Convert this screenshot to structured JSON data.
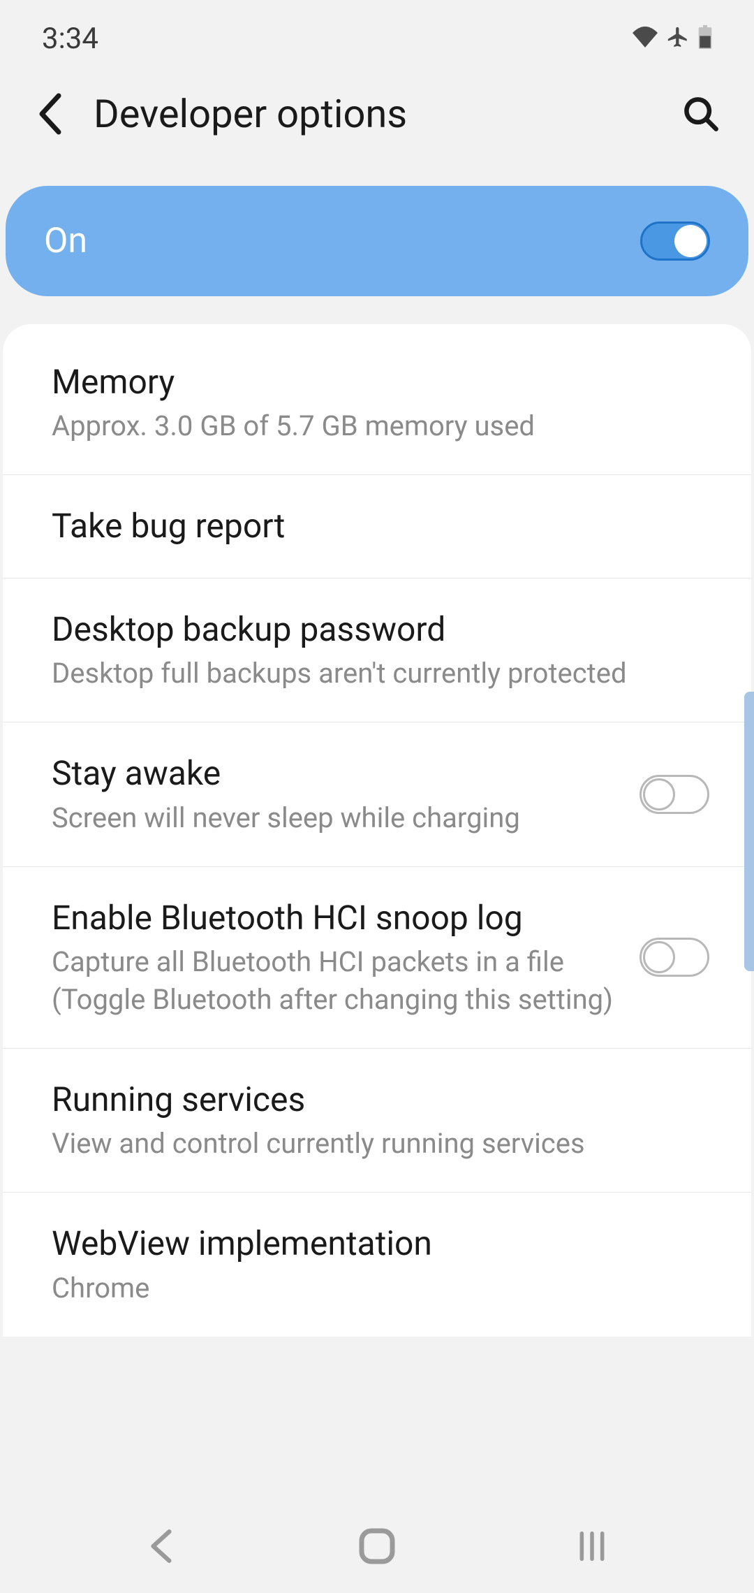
{
  "status": {
    "time": "3:34"
  },
  "header": {
    "title": "Developer options"
  },
  "masterToggle": {
    "label": "On",
    "enabled": true
  },
  "settings": [
    {
      "title": "Memory",
      "subtitle": "Approx. 3.0 GB of 5.7 GB memory used",
      "hasToggle": false
    },
    {
      "title": "Take bug report",
      "subtitle": "",
      "hasToggle": false
    },
    {
      "title": "Desktop backup password",
      "subtitle": "Desktop full backups aren't currently protected",
      "hasToggle": false
    },
    {
      "title": "Stay awake",
      "subtitle": "Screen will never sleep while charging",
      "hasToggle": true,
      "toggleOn": false
    },
    {
      "title": "Enable Bluetooth HCI snoop log",
      "subtitle": "Capture all Bluetooth HCI packets in a file (Toggle Bluetooth after changing this setting)",
      "hasToggle": true,
      "toggleOn": false
    },
    {
      "title": "Running services",
      "subtitle": "View and control currently running services",
      "hasToggle": false
    },
    {
      "title": "WebView implementation",
      "subtitle": "Chrome",
      "hasToggle": false
    }
  ]
}
